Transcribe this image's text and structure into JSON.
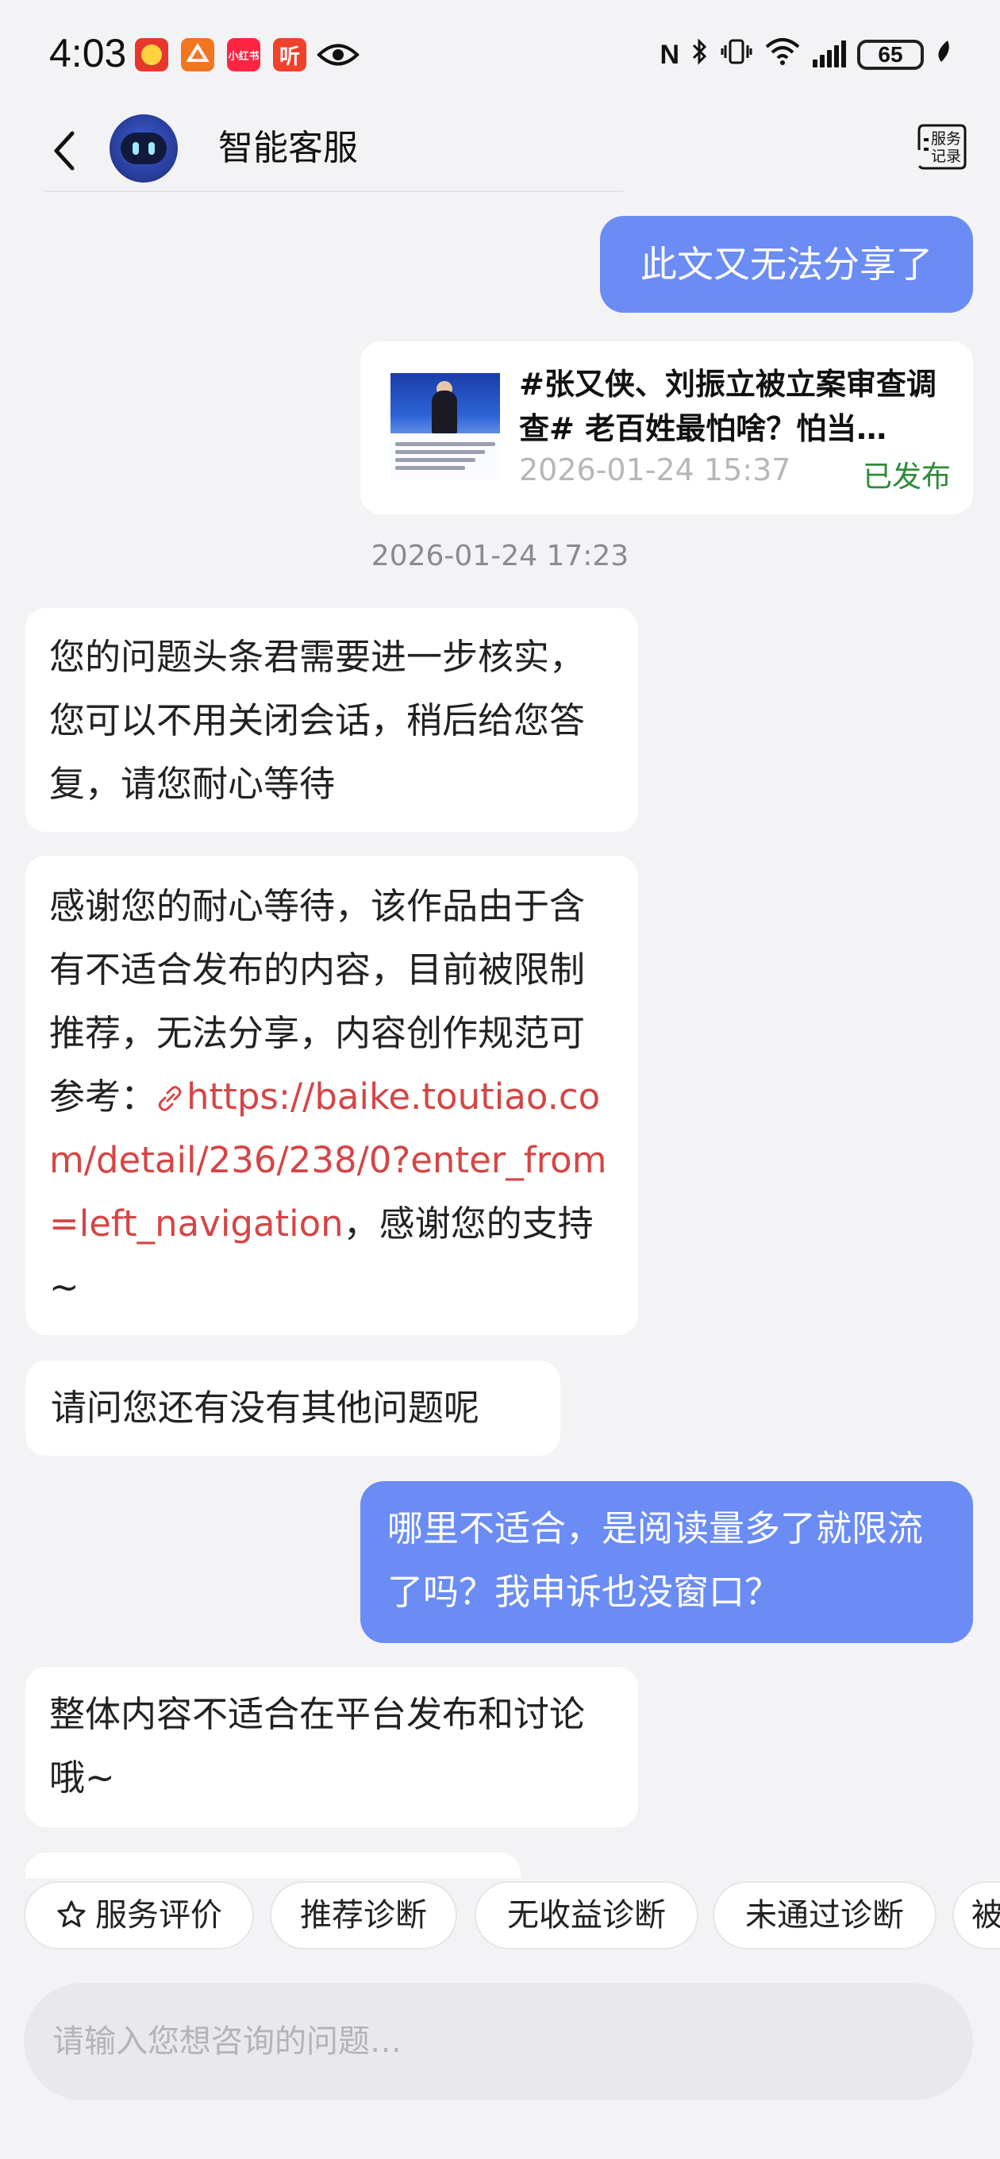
{
  "status_bar": {
    "time": "4:03",
    "battery": "65",
    "app_icons": [
      {
        "name": "app-icon-1",
        "label": "",
        "color": "#e8372c"
      },
      {
        "name": "app-icon-2",
        "label": "",
        "color": "#f2751f"
      },
      {
        "name": "app-icon-3",
        "label": "小红书",
        "color": "#ff2442"
      },
      {
        "name": "app-icon-4",
        "label": "听",
        "color": "#f0412b"
      }
    ]
  },
  "header": {
    "title": "智能客服",
    "records_label": "服务记录"
  },
  "article_card": {
    "title": "#张又侠、刘振立被立案审查调查# 老百姓最怕啥？怕当…",
    "date": "2026-01-24 15:37",
    "status": "已发布"
  },
  "messages": {
    "m1": {
      "text": "此文又无法分享了"
    },
    "timestamp": "2026-01-24 17:23",
    "m2": {
      "text": "您的问题头条君需要进一步核实，您可以不用关闭会话，稍后给您答复，请您耐心等待"
    },
    "m3": {
      "text_before": "感谢您的耐心等待，该作品由于含有不适合发布的内容，目前被限制推荐，无法分享，内容创作规范可参考：",
      "link": "https://baike.toutiao.com/detail/236/238/0?enter_from=left_navigation",
      "text_after": "，感谢您的支持~"
    },
    "m4": {
      "text": "请问您还有没有其他问题呢"
    },
    "m5": {
      "text": "哪里不适合，是阅读量多了就限流了吗？我申诉也没窗口？"
    },
    "m6": {
      "text": "整体内容不适合在平台发布和讨论哦~"
    }
  },
  "quick_actions": [
    {
      "label": "服务评价",
      "icon": "star-icon"
    },
    {
      "label": "推荐诊断"
    },
    {
      "label": "无收益诊断"
    },
    {
      "label": "未通过诊断"
    },
    {
      "label": "被"
    }
  ],
  "input": {
    "placeholder": "请输入您想咨询的问题…",
    "value": ""
  },
  "colors": {
    "user_bubble": "#6b8cf5",
    "bot_bubble": "#ffffff",
    "link": "#d64545",
    "published": "#2e8b3a",
    "background": "#f3f3f5"
  }
}
